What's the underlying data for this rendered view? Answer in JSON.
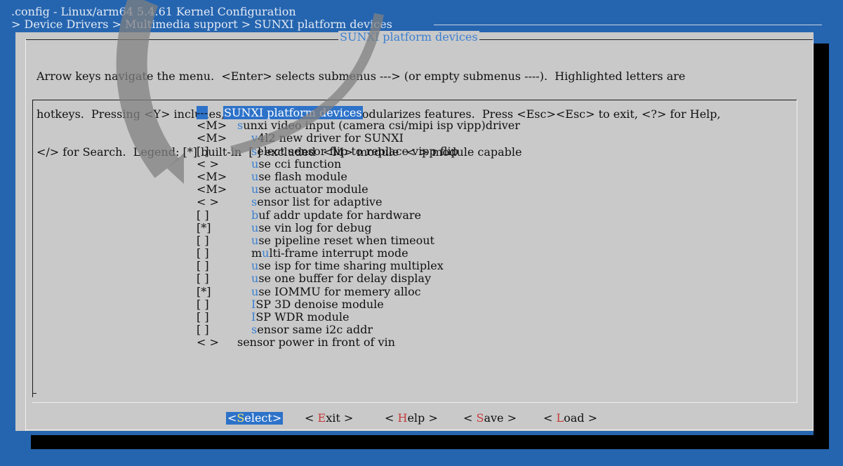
{
  "header": {
    "title": ".config - Linux/arm64 5.4.61 Kernel Configuration",
    "breadcrumb": "> Device Drivers > Multimedia support > SUNXI platform devices"
  },
  "dialog": {
    "title": "SUNXI platform devices",
    "help_lines": [
      "Arrow keys navigate the menu.  <Enter> selects submenus ---> (or empty submenus ----).  Highlighted letters are",
      "hotkeys.  Pressing <Y> includes, <N> excludes, <M> modularizes features.  Press <Esc><Esc> to exit, <?> for Help,",
      "</> for Search.  Legend: [*] built-in  [ ] excluded  <M> module  < > module capable"
    ]
  },
  "menu": {
    "items": [
      {
        "box": "---",
        "hotkey": "",
        "rest": "SUNXI platform devices",
        "level": 0
      },
      {
        "box": "<M>",
        "hotkey": "s",
        "rest": "unxi video input (camera csi/mipi isp vipp)driver",
        "level": 0
      },
      {
        "box": "<M>",
        "hotkey": "v",
        "rest": "4l2 new driver for SUNXI",
        "level": 1
      },
      {
        "box": "[ ]",
        "hotkey": "s",
        "rest": "elect sensor flip to replace vipp flip",
        "level": 1
      },
      {
        "box": "< >",
        "hotkey": "u",
        "rest": "se cci function",
        "level": 1
      },
      {
        "box": "<M>",
        "hotkey": "u",
        "rest": "se flash module",
        "level": 1
      },
      {
        "box": "<M>",
        "hotkey": "u",
        "rest": "se actuator module",
        "level": 1
      },
      {
        "box": "< >",
        "hotkey": "s",
        "rest": "ensor list for adaptive",
        "level": 1
      },
      {
        "box": "[ ]",
        "hotkey": "b",
        "rest": "uf addr update for hardware",
        "level": 1
      },
      {
        "box": "[*]",
        "hotkey": "u",
        "rest": "se vin log for debug",
        "level": 1
      },
      {
        "box": "[ ]",
        "hotkey": "u",
        "rest": "se pipeline reset when timeout",
        "level": 1
      },
      {
        "box": "[ ]",
        "hotkey": "mu",
        "hotkey_pos": 1,
        "rest": "lti-frame interrupt mode",
        "level": 1
      },
      {
        "box": "[ ]",
        "hotkey": "u",
        "rest": "se isp for time sharing multiplex",
        "level": 1
      },
      {
        "box": "[ ]",
        "hotkey": "u",
        "rest": "se one buffer for delay display",
        "level": 1
      },
      {
        "box": "[*]",
        "hotkey": "u",
        "rest": "se IOMMU for memery alloc",
        "level": 1
      },
      {
        "box": "[ ]",
        "hotkey": "I",
        "rest": "SP 3D denoise module",
        "level": 1
      },
      {
        "box": "[ ]",
        "hotkey": "I",
        "rest": "SP WDR module",
        "level": 1
      },
      {
        "box": "[ ]",
        "hotkey": "s",
        "rest": "ensor same i2c addr",
        "level": 1
      },
      {
        "box": "< >",
        "hotkey": "",
        "rest": "sensor power in front of vin",
        "level": 0
      }
    ]
  },
  "buttons": [
    {
      "open": "<",
      "key": "S",
      "rest": "elect",
      "close": ">",
      "active": true
    },
    {
      "open": "< ",
      "key": "E",
      "rest": "xit",
      "close": " >",
      "active": false
    },
    {
      "open": "< ",
      "key": "H",
      "rest": "elp",
      "close": " >",
      "active": false
    },
    {
      "open": "< ",
      "key": "S",
      "rest": "ave",
      "close": " >",
      "active": false
    },
    {
      "open": "< ",
      "key": "L",
      "rest": "oad",
      "close": " >",
      "active": false
    }
  ],
  "colors": {
    "background": "#2565b0",
    "dialog": "#c9c9c9",
    "highlight": "#2d72c9",
    "hotkey": "#3a7fd0",
    "button_hotkey": "#c83a3a"
  }
}
